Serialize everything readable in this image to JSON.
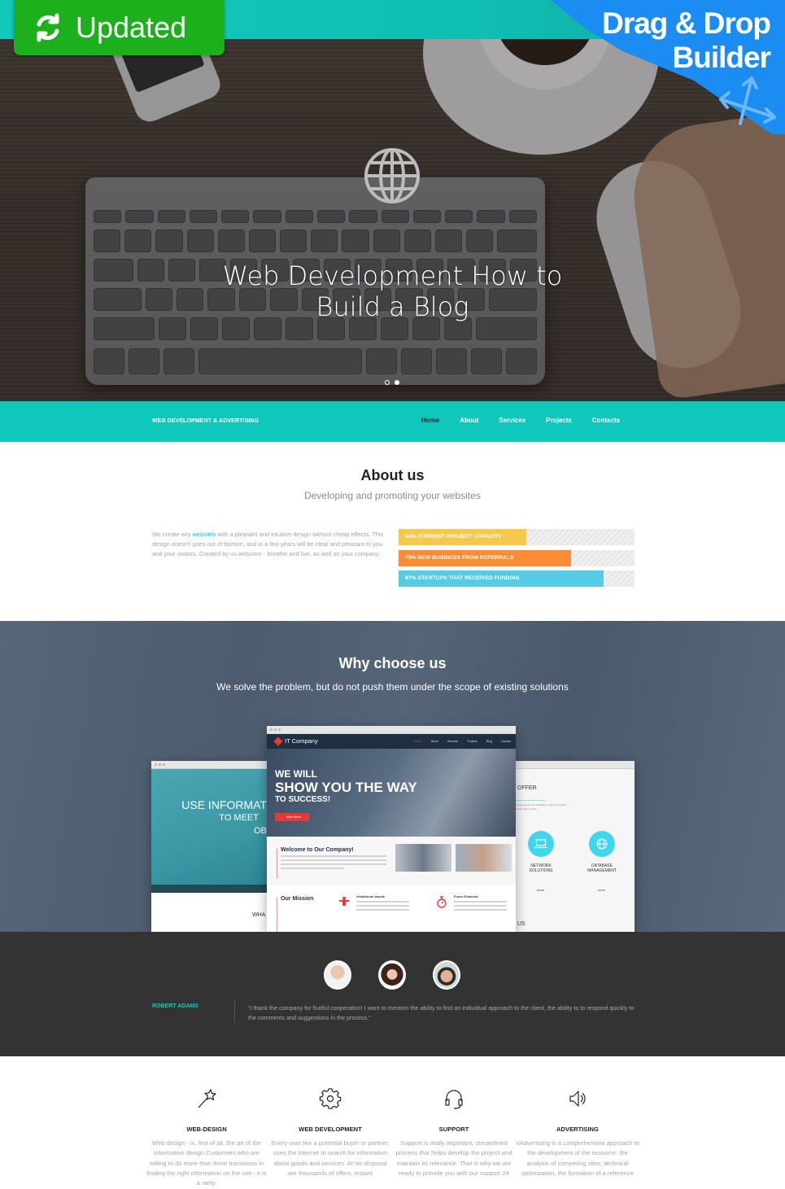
{
  "promo": {
    "updated_label": "Updated",
    "builder_line1": "Drag & Drop",
    "builder_line2": "Builder",
    "colors": {
      "updated_bg": "#1cb01c",
      "builder_bg": "#1a8cf2",
      "band": "#13c7ba"
    }
  },
  "hero": {
    "title_line1": "Web Development How to",
    "title_line2": "Build a Blog",
    "icon": "globe-icon",
    "slides": [
      {
        "active": false
      },
      {
        "active": true
      }
    ]
  },
  "nav": {
    "brand": "WEB DEVELOPMENT & ADVERTISING",
    "links": [
      {
        "label": "Home",
        "active": true
      },
      {
        "label": "About",
        "active": false
      },
      {
        "label": "Services",
        "active": false
      },
      {
        "label": "Projects",
        "active": false
      },
      {
        "label": "Contacts",
        "active": false
      }
    ],
    "color": "#10c7bc"
  },
  "about": {
    "title": "About us",
    "subtitle": "Developing and promoting your websites",
    "text_before_link": "We create airy ",
    "link_text": "websites",
    "text_after_link": " with a pleasant and intuitive design without cheap effects. This design doesn't goes out of fashion, and in a few years will be clear and pleasant to you and your visitors. Created by us websites - breathe and live, as well as your company.",
    "bars": [
      {
        "label": "54% CURRENT PROJECT CAPACITY",
        "percent": 54,
        "color": "#f6c94e"
      },
      {
        "label": "73%  NEW BUSINESS FROM REFERRALS",
        "percent": 73,
        "color": "#fb8c33"
      },
      {
        "label": "87%  STARTUPS THAT RECEIVED FUNDING",
        "percent": 87,
        "color": "#55cbe5"
      }
    ]
  },
  "why": {
    "title": "Why choose us",
    "subtitle": "We solve the problem, but do not push them under the scope of existing solutions",
    "mockup_main": {
      "logo": "IT Company",
      "nav": [
        "Home",
        "About",
        "Services",
        "Projects",
        "Blog",
        "Contact"
      ],
      "hero_line1": "WE WILL",
      "hero_line2": "SHOW YOU THE WAY",
      "hero_line3": "TO SUCCESS!",
      "button": "View More",
      "welcome_title": "Welcome to Our Company!",
      "mission_title": "Our Mission",
      "col1_title": "Vestibulum Iaculis",
      "col2_title": "Fusce Euismod"
    },
    "mockup_left": {
      "line1": "USE INFORMAT",
      "line2": "TO MEET",
      "line3": "OB",
      "bottom": "WHA"
    },
    "mockup_right": {
      "heading": "OFFER",
      "service1": "NETWORK SOLUTIONS",
      "service2": "DATABASE MANAGEMENT",
      "more": "more",
      "bottom": "US"
    }
  },
  "testimonial": {
    "name": "ROBERT ADAMS",
    "quote": "“I thank the company for fruitful cooperation! I want to mention the ability to find an individual approach to the client, the ability to to respond quickly to the comments and suggestions in the process.”",
    "avatars": [
      "avatar-older-man",
      "avatar-woman",
      "avatar-young-man"
    ]
  },
  "features": [
    {
      "icon": "magic-wand-icon",
      "title": "WEB-DESIGN",
      "text": "Web design - is, first of all, the art of the information design.Customers who are willing to do more than three transitions in finding the right information on the site - it is a rarity,"
    },
    {
      "icon": "gear-icon",
      "title": "WEB DEVELOPMENT",
      "text": "Every user like a potential buyer or partner, uses the Internet to search for information about goods and services. At his disposal are thousands of offers, instant"
    },
    {
      "icon": "headset-icon",
      "title": "SUPPORT",
      "text": "Support is really important, streamlined process that helps develop the project and maintain its relevance. That is why we are ready to provide you with our support 24"
    },
    {
      "icon": "speaker-icon",
      "title": "ADVERTISING",
      "text": "VAdvertising is a comprehensive approach to the development of the resource: the analysis of competing sites, technical optimization, the formation of a reference"
    }
  ]
}
